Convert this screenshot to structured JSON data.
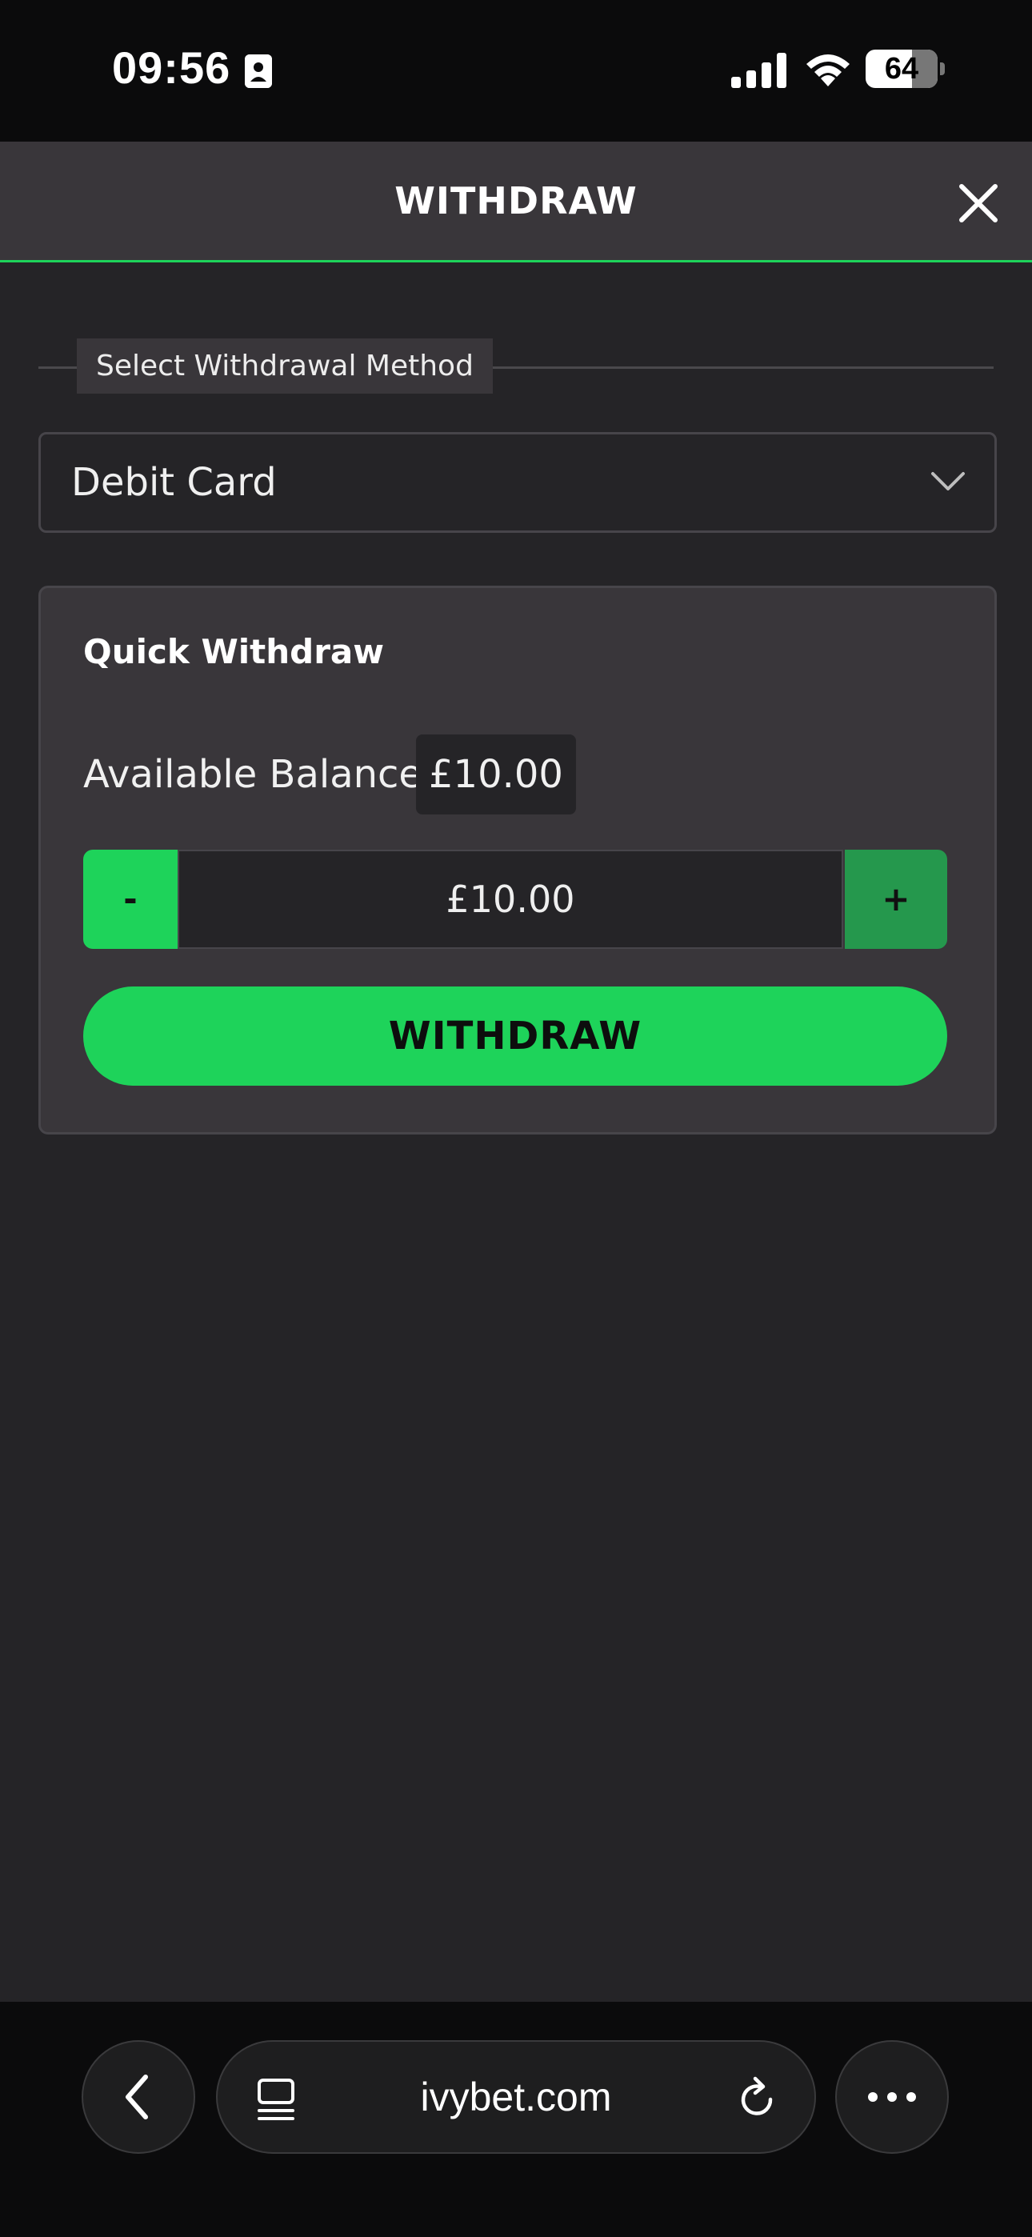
{
  "status_bar": {
    "time": "09:56",
    "battery": "64"
  },
  "header": {
    "title": "WITHDRAW",
    "close_icon": "close-icon"
  },
  "method": {
    "legend": "Select Withdrawal Method",
    "selected": "Debit Card"
  },
  "quick_withdraw": {
    "title": "Quick Withdraw",
    "balance_label": "Available Balance:",
    "balance_value": "£10.00",
    "minus_label": "-",
    "amount": "£10.00",
    "plus_label": "+",
    "withdraw_label": "WITHDRAW"
  },
  "browser": {
    "url": "ivybet.com"
  },
  "colors": {
    "accent": "#1ed35a",
    "accent_dark": "#25984d",
    "background": "#252427",
    "panel": "#39363a"
  }
}
